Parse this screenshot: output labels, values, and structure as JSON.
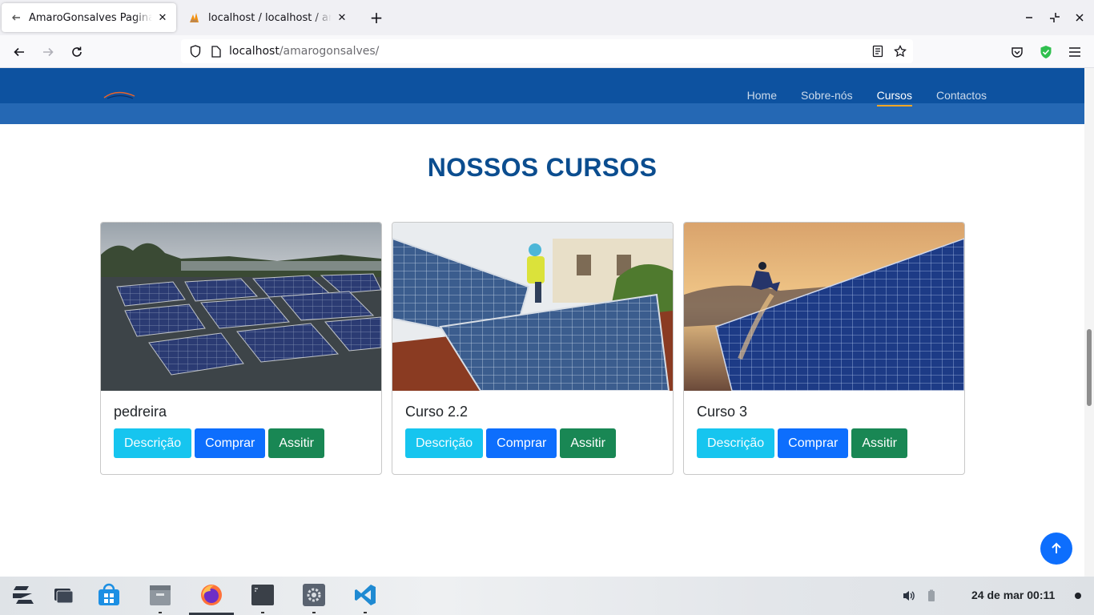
{
  "browser": {
    "tabs": [
      {
        "title": "AmaroGonsalves Pagina Inicial",
        "active": true
      },
      {
        "title": "localhost / localhost / amarogonsalves",
        "active": false
      }
    ],
    "url": {
      "host": "localhost",
      "path": "/amarogonsalves/"
    }
  },
  "site": {
    "nav": [
      {
        "label": "Home",
        "active": false
      },
      {
        "label": "Sobre-nós",
        "active": false
      },
      {
        "label": "Cursos",
        "active": true
      },
      {
        "label": "Contactos",
        "active": false
      }
    ],
    "section_title": "NOSSOS CURSOS",
    "courses": [
      {
        "title": "pedreira",
        "image": "solar-panels-roof-photo",
        "buttons": {
          "description": "Descrição",
          "buy": "Comprar",
          "watch": "Assitir"
        }
      },
      {
        "title": "Curso 2.2",
        "image": "solar-panel-installation-photo",
        "buttons": {
          "description": "Descrição",
          "buy": "Comprar",
          "watch": "Assitir"
        }
      },
      {
        "title": "Curso 3",
        "image": "solar-panels-sunset-photo",
        "buttons": {
          "description": "Descrição",
          "buy": "Comprar",
          "watch": "Assitir"
        }
      }
    ]
  },
  "taskbar": {
    "apps": [
      "zorin-menu-icon",
      "workspaces-icon",
      "software-store-icon",
      "files-icon",
      "firefox-icon",
      "terminal-icon",
      "settings-icon",
      "vscode-icon"
    ],
    "clock": "24 de mar  00:11"
  },
  "colors": {
    "header": "#0d52a0",
    "title": "#0b4d8f",
    "btn_info": "#16c5ef",
    "btn_primary": "#0d6efd",
    "btn_success": "#198754",
    "nav_active_underline": "#f5a623"
  }
}
